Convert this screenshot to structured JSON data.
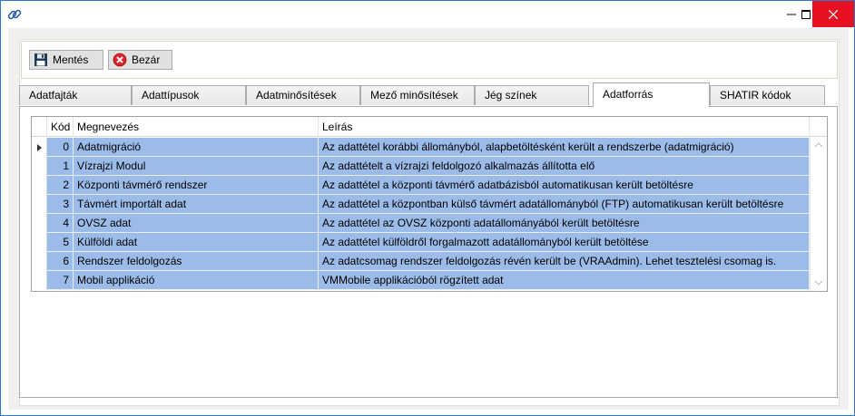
{
  "window": {
    "icon": "link-chain-icon",
    "controls": {
      "minimize": "minimize-icon",
      "maximize": "maximize-icon",
      "close": "close-icon"
    }
  },
  "toolbar": {
    "save_label": "Mentés",
    "save_icon": "floppy-disk-icon",
    "close_label": "Bezár",
    "close_icon": "red-cancel-icon"
  },
  "tabs": [
    {
      "label": "Adatfajták",
      "active": false
    },
    {
      "label": "Adattípusok",
      "active": false
    },
    {
      "label": "Adatminősítések",
      "active": false
    },
    {
      "label": "Mező minősítések",
      "active": false
    },
    {
      "label": "Jég színek",
      "active": false
    },
    {
      "label": "Adatforrás",
      "active": true
    },
    {
      "label": "SHATIR kódok",
      "active": false
    }
  ],
  "grid": {
    "columns": {
      "kod": "Kód",
      "name": "Megnevezés",
      "desc": "Leírás"
    },
    "rows": [
      {
        "kod": "0",
        "name": "Adatmigráció",
        "desc": "Az adattétel korábbi állományból, alapbetöltésként került a rendszerbe (adatmigráció)"
      },
      {
        "kod": "1",
        "name": "Vízrajzi Modul",
        "desc": "Az adattételt a vízrajzi feldolgozó alkalmazás állította elő"
      },
      {
        "kod": "2",
        "name": "Központi távmérő rendszer",
        "desc": "Az adattétel a központi távmérő adatbázisból automatikusan került betöltésre"
      },
      {
        "kod": "3",
        "name": "Távmért importált adat",
        "desc": "Az adattétel a központban külső távmért adatállományból (FTP) automatikusan került betöltésre"
      },
      {
        "kod": "4",
        "name": "OVSZ adat",
        "desc": "Az adattétel az OVSZ központi adatállományából került betöltésre"
      },
      {
        "kod": "5",
        "name": "Külföldi adat",
        "desc": "Az adattétel külföldről forgalmazott adatállományból került betöltése"
      },
      {
        "kod": "6",
        "name": "Rendszer feldolgozás",
        "desc": "Az adatcsomag rendszer feldolgozás révén került be (VRAAdmin). Lehet tesztelési csomag is."
      },
      {
        "kod": "7",
        "name": "Mobil applikáció",
        "desc": "VMMobile applikációból rögzített adat"
      }
    ],
    "selection_color": "#9bbbe9"
  }
}
